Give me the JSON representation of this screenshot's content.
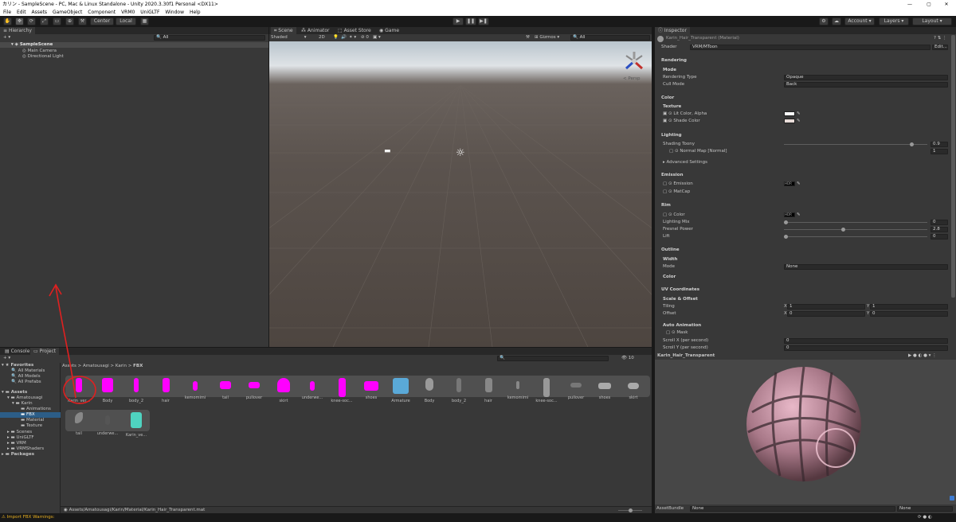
{
  "window": {
    "title": "カリン - SampleScene - PC, Mac & Linux Standalone - Unity 2020.3.30f1 Personal <DX11>",
    "min": "—",
    "max": "▢",
    "close": "✕"
  },
  "menu": [
    "File",
    "Edit",
    "Assets",
    "GameObject",
    "Component",
    "VRM0",
    "UniGLTF",
    "Window",
    "Help"
  ],
  "toolbar": {
    "pivot": "Center",
    "space": "Local",
    "account": "Account",
    "layers": "Layers",
    "layout": "Layout"
  },
  "hierarchy": {
    "tab": "Hierarchy",
    "search_placeholder": "All",
    "scene": "SampleScene",
    "items": [
      "Main Camera",
      "Directional Light"
    ]
  },
  "scene_view": {
    "tabs": [
      "Scene",
      "Animator",
      "Asset Store",
      "Game"
    ],
    "shading": "Shaded",
    "mode2d": "2D",
    "gizmos": "Gizmos",
    "search_placeholder": "All",
    "persp": "< Persp"
  },
  "project": {
    "tabs": [
      "Console",
      "Project"
    ],
    "favorites_label": "Favorites",
    "favorites": [
      "All Materials",
      "All Models",
      "All Prefabs"
    ],
    "assets_label": "Assets",
    "tree": [
      "Amatousagi",
      "Karin",
      "Animations",
      "FBX",
      "Material",
      "Texture",
      "Scenes",
      "UniGLTF",
      "VRM",
      "VRMShaders"
    ],
    "packages_label": "Packages",
    "breadcrumb": [
      "Assets",
      "Amatousagi",
      "Karin",
      "FBX"
    ],
    "hidden_count": "10",
    "row1": [
      "Karin_ver...",
      "Body",
      "body_2",
      "hair",
      "kemomimi",
      "tail",
      "pullover",
      "skirt",
      "underwe...",
      "knee-soc...",
      "shoes",
      "Armature",
      "Body",
      "body_2",
      "hair",
      "kemomimi",
      "knee-soc...",
      "pullover",
      "shoes",
      "skirt"
    ],
    "row2": [
      "tail",
      "underwe...",
      "Karin_ve..."
    ],
    "status_path": "Assets/Amatousagi/Karin/Material/Karin_Hair_Transparent.mat"
  },
  "inspector": {
    "tab": "Inspector",
    "material_name": "Karin_Hair_Transparent (Material)",
    "shader_label": "Shader",
    "shader_value": "VRM/MToon",
    "edit_label": "Edit...",
    "rendering": "Rendering",
    "mode": "Mode",
    "rendering_type_label": "Rendering Type",
    "rendering_type_value": "Opaque",
    "cull_mode_label": "Cull Mode",
    "cull_mode_value": "Back",
    "color": "Color",
    "texture": "Texture",
    "lit_color": "Lit Color, Alpha",
    "shade_color": "Shade Color",
    "lighting": "Lighting",
    "shading_toony_label": "Shading Toony",
    "shading_toony_value": "0.9",
    "normal_map_label": "Normal Map [Normal]",
    "normal_map_value": "1",
    "advanced": "Advanced Settings",
    "emission_section": "Emission",
    "emission_label": "Emission",
    "matcap_label": "MatCap",
    "rim_section": "Rim",
    "rim_color": "Color",
    "lighting_mix_label": "Lighting Mix",
    "lighting_mix_value": "0",
    "fresnel_label": "Fresnel Power",
    "fresnel_value": "2.8",
    "lift_label": "Lift",
    "lift_value": "0",
    "outline": "Outline",
    "width": "Width",
    "outline_mode_label": "Mode",
    "outline_mode_value": "None",
    "outline_color": "Color",
    "uv": "UV Coordinates",
    "scale_offset": "Scale & Offset",
    "tiling_label": "Tiling",
    "offset_label": "Offset",
    "x": "X",
    "y": "Y",
    "tiling_x": "1",
    "tiling_y": "1",
    "offset_x": "0",
    "offset_y": "0",
    "auto_anim": "Auto Animation",
    "mask_label": "Mask",
    "scroll_x_label": "Scroll X (per second)",
    "scroll_x_value": "0",
    "scroll_y_label": "Scroll Y (per second)",
    "scroll_y_value": "0",
    "hdr": "HDR",
    "preview_title": "Karin_Hair_Transparent",
    "assetbundle_label": "AssetBundle",
    "assetbundle_value": "None",
    "assetbundle_variant": "None"
  },
  "statusbar": {
    "warning": "Import FBX Warnings:"
  },
  "colors": {
    "magenta": "#ff00ff",
    "annotation": "#e02020",
    "accent": "#2c5d87"
  }
}
